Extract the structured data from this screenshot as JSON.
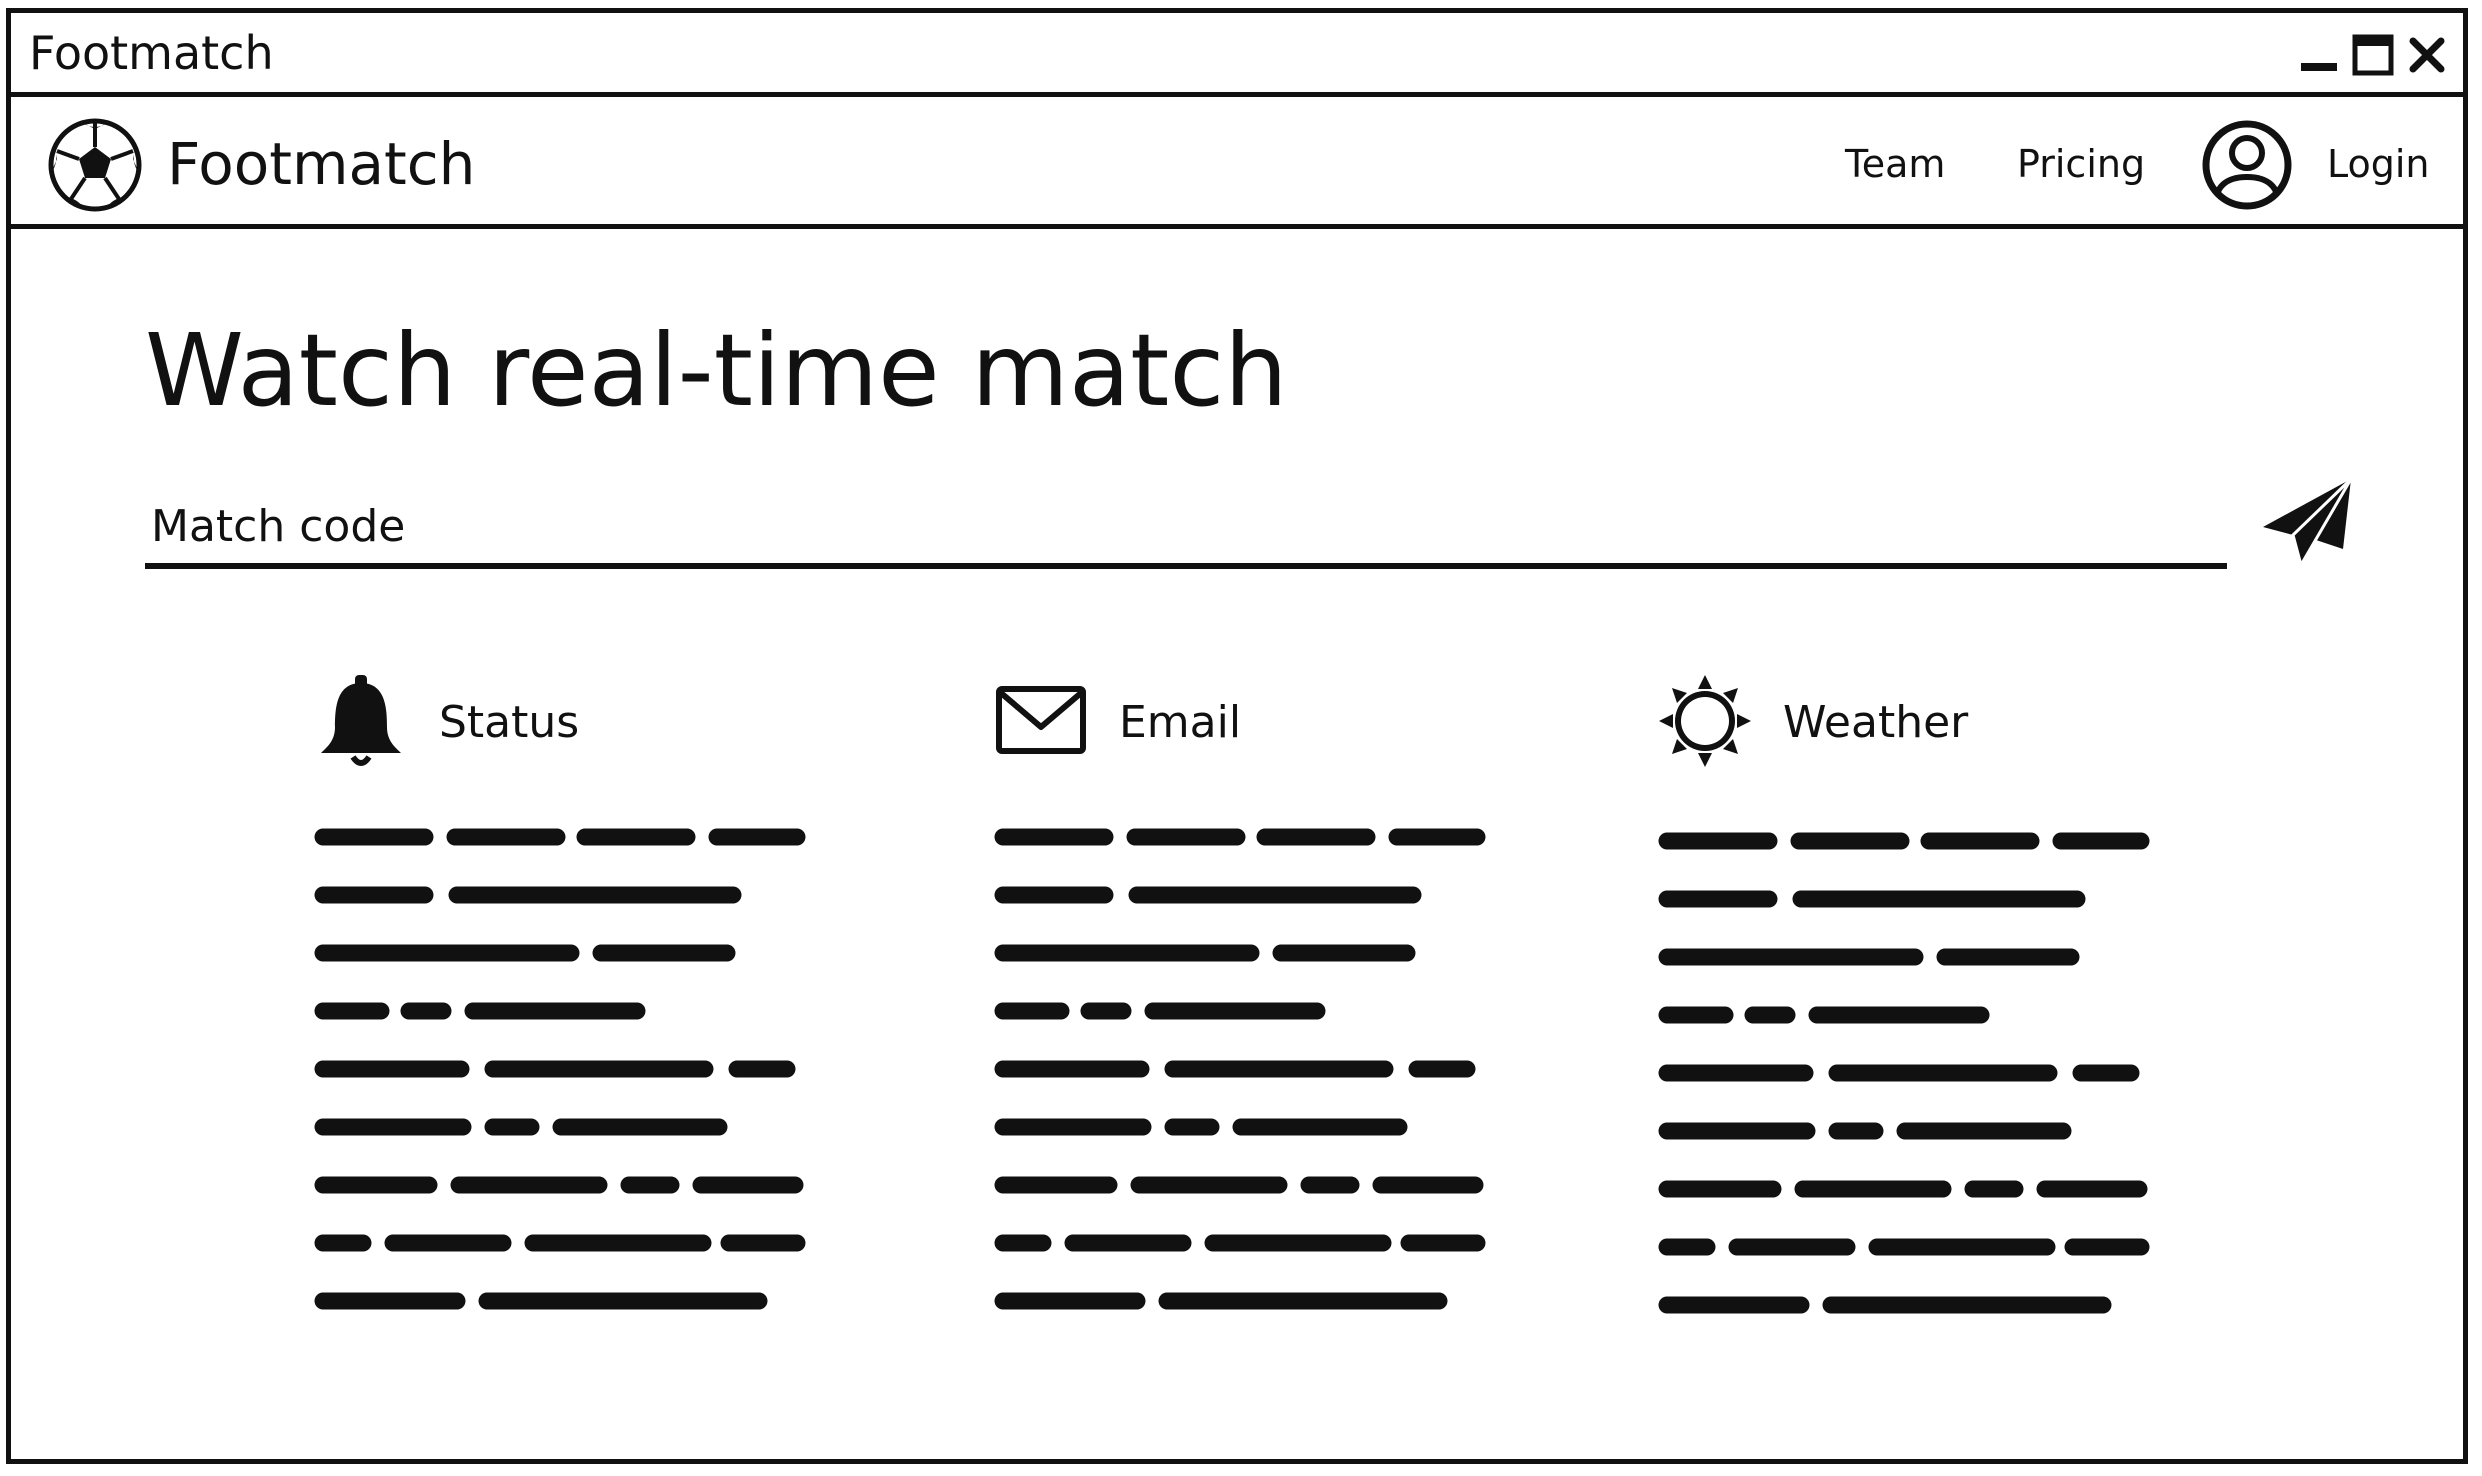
{
  "window": {
    "title": "Footmatch"
  },
  "navbar": {
    "brand": "Footmatch",
    "links": {
      "team": "Team",
      "pricing": "Pricing",
      "login": "Login"
    }
  },
  "main": {
    "title": "Watch real-time match",
    "match_code_placeholder": "Match code",
    "features": [
      {
        "title": "Status",
        "icon": "bell-icon"
      },
      {
        "title": "Email",
        "icon": "envelope-icon"
      },
      {
        "title": "Weather",
        "icon": "sun-icon"
      }
    ]
  },
  "colors": {
    "ink": "#111111",
    "background": "#ffffff"
  }
}
